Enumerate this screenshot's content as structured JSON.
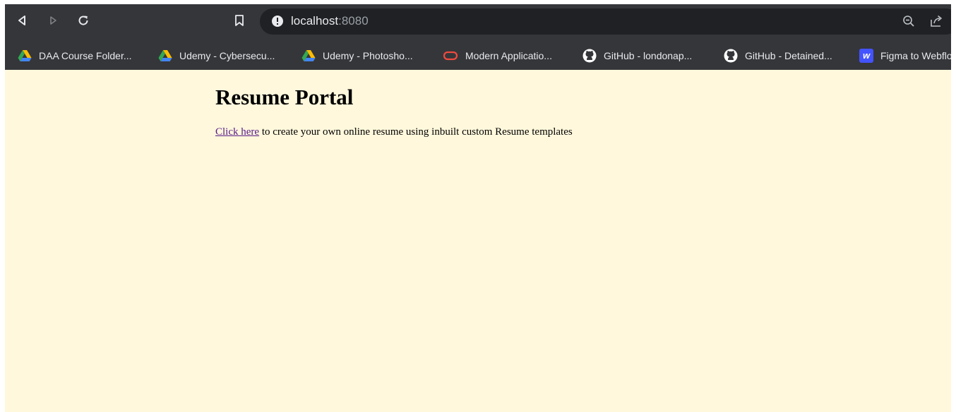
{
  "browser": {
    "url_host": "localhost",
    "url_port": ":8080",
    "icons": {
      "back": "back-arrow-icon",
      "forward": "forward-arrow-icon",
      "reload": "reload-icon",
      "bookmark": "bookmark-icon",
      "site_info": "info-icon",
      "zoom": "zoom-out-icon",
      "share": "share-icon"
    },
    "bookmarks": [
      {
        "label": "DAA Course Folder...",
        "icon": "google-drive-icon"
      },
      {
        "label": "Udemy - Cybersecu...",
        "icon": "google-drive-icon"
      },
      {
        "label": "Udemy - Photosho...",
        "icon": "google-drive-icon"
      },
      {
        "label": "Modern Applicatio...",
        "icon": "oracle-icon"
      },
      {
        "label": "GitHub - londonap...",
        "icon": "github-icon"
      },
      {
        "label": "GitHub - Detained...",
        "icon": "github-icon"
      },
      {
        "label": "Figma to Webflow",
        "icon": "webflow-icon",
        "icon_text": "w"
      }
    ]
  },
  "page": {
    "title": "Resume Portal",
    "link_text": "Click here",
    "intro_rest": " to create your own online resume using inbuilt custom Resume templates"
  },
  "colors": {
    "toolbar": "#35363a",
    "omnibox": "#202124",
    "page_background": "#fff8dc",
    "visited_link": "#551a8b"
  }
}
